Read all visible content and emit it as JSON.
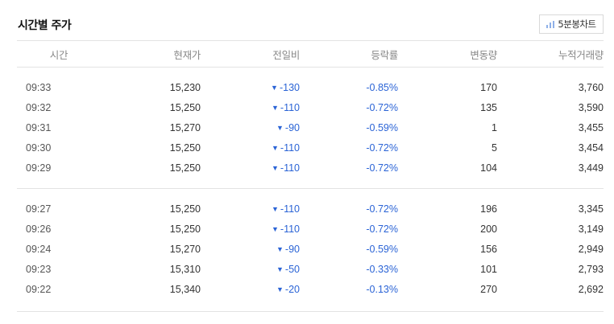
{
  "section": {
    "title": "시간별 주가",
    "chart_button_label": "5분봉차트"
  },
  "columns": [
    "시간",
    "현재가",
    "전일비",
    "등락률",
    "변동량",
    "누적거래량"
  ],
  "groups": [
    [
      {
        "time": "09:33",
        "price": "15,230",
        "diff": "-130",
        "rate": "-0.85%",
        "change": "170",
        "accum": "3,760"
      },
      {
        "time": "09:32",
        "price": "15,250",
        "diff": "-110",
        "rate": "-0.72%",
        "change": "135",
        "accum": "3,590"
      },
      {
        "time": "09:31",
        "price": "15,270",
        "diff": "-90",
        "rate": "-0.59%",
        "change": "1",
        "accum": "3,455"
      },
      {
        "time": "09:30",
        "price": "15,250",
        "diff": "-110",
        "rate": "-0.72%",
        "change": "5",
        "accum": "3,454"
      },
      {
        "time": "09:29",
        "price": "15,250",
        "diff": "-110",
        "rate": "-0.72%",
        "change": "104",
        "accum": "3,449"
      }
    ],
    [
      {
        "time": "09:27",
        "price": "15,250",
        "diff": "-110",
        "rate": "-0.72%",
        "change": "196",
        "accum": "3,345"
      },
      {
        "time": "09:26",
        "price": "15,250",
        "diff": "-110",
        "rate": "-0.72%",
        "change": "200",
        "accum": "3,149"
      },
      {
        "time": "09:24",
        "price": "15,270",
        "diff": "-90",
        "rate": "-0.59%",
        "change": "156",
        "accum": "2,949"
      },
      {
        "time": "09:23",
        "price": "15,310",
        "diff": "-50",
        "rate": "-0.33%",
        "change": "101",
        "accum": "2,793"
      },
      {
        "time": "09:22",
        "price": "15,340",
        "diff": "-20",
        "rate": "-0.13%",
        "change": "270",
        "accum": "2,692"
      }
    ]
  ],
  "colors": {
    "down": "#2b64d6",
    "chart_icon": "#8fb0e8"
  }
}
